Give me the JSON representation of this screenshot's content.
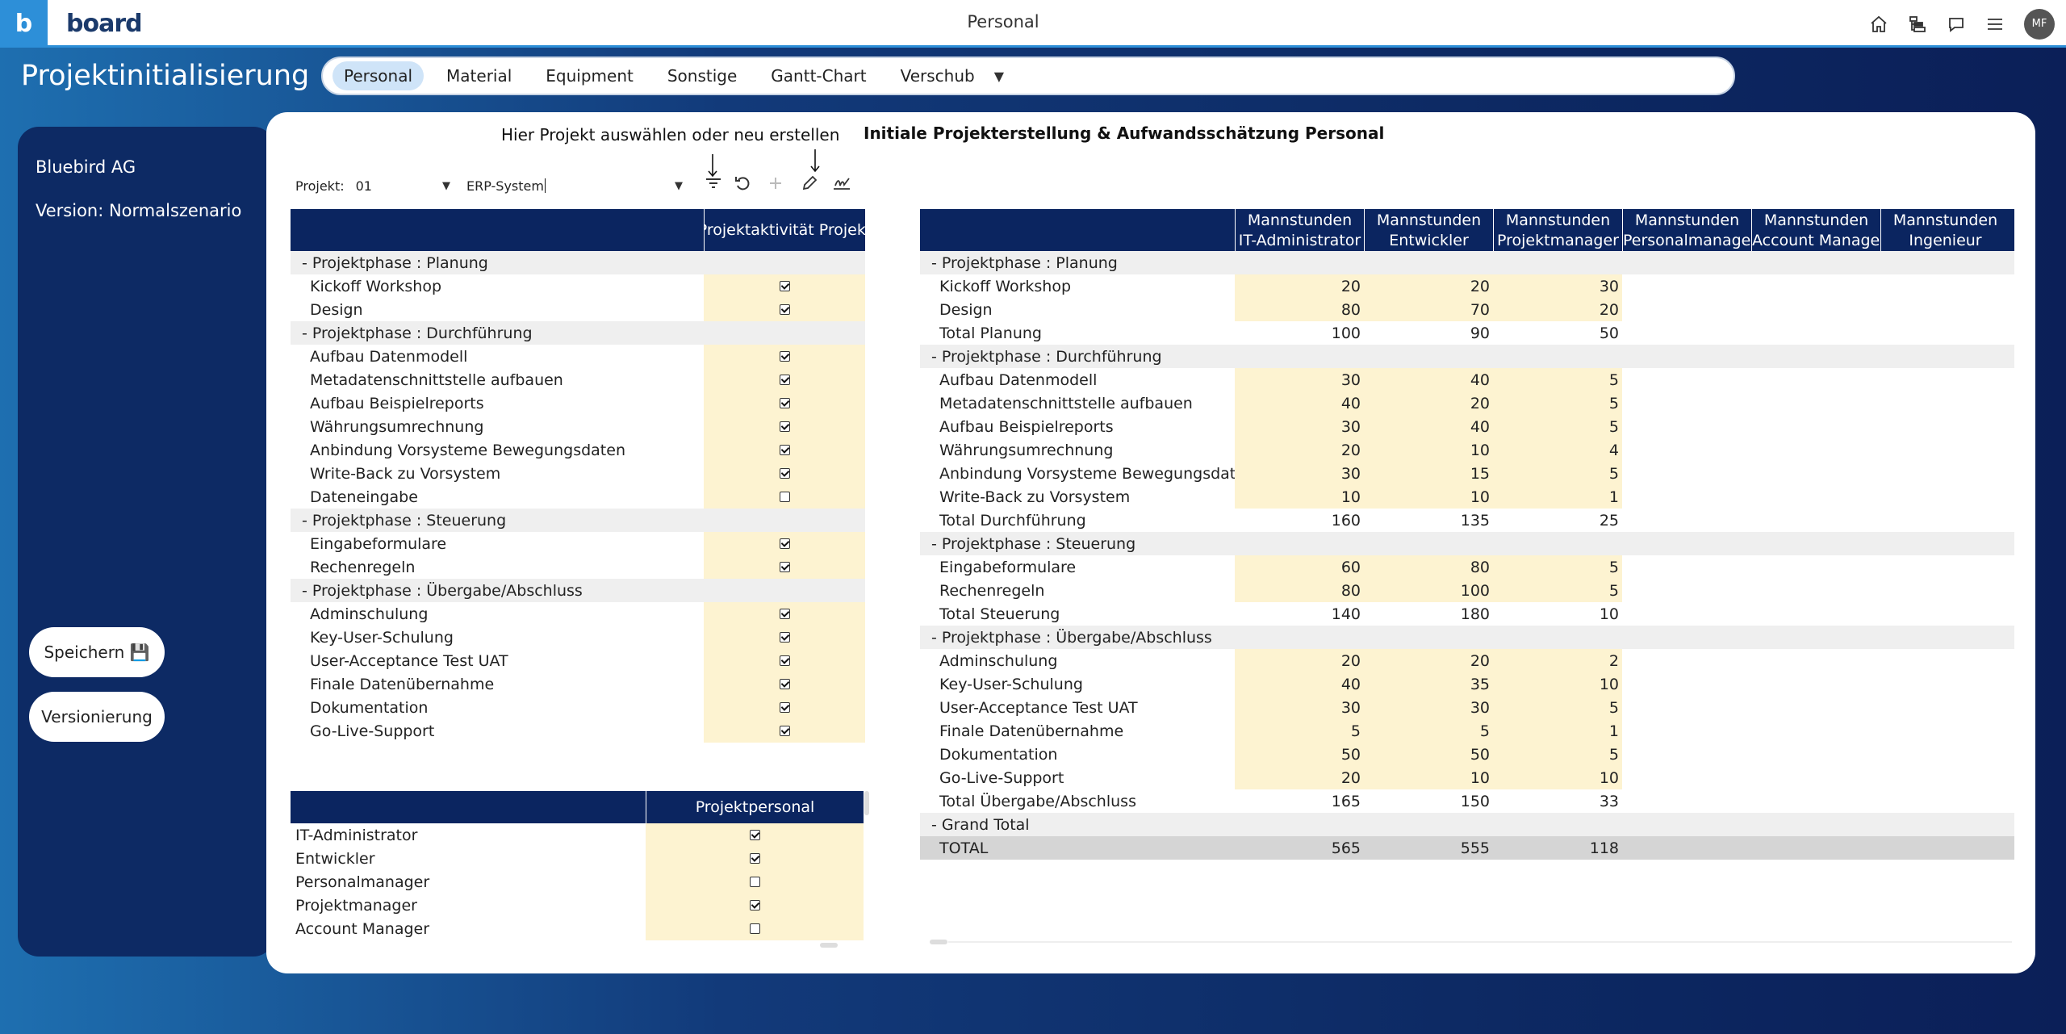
{
  "app": {
    "logo_letter": "b",
    "logo_name": "board",
    "window_title": "Personal",
    "avatar_initials": "MF"
  },
  "page": {
    "title": "Projektinitialisierung"
  },
  "tabs": [
    {
      "label": "Personal",
      "active": true
    },
    {
      "label": "Material",
      "active": false
    },
    {
      "label": "Equipment",
      "active": false
    },
    {
      "label": "Sonstige",
      "active": false
    },
    {
      "label": "Gantt-Chart",
      "active": false
    },
    {
      "label": "Verschub",
      "active": false
    }
  ],
  "tabs_more_symbol": "▼",
  "sidebar": {
    "company": "Bluebird AG",
    "version": "Version: Normalszenario",
    "save_label": "Speichern 💾",
    "versioning_label": "Versionierung"
  },
  "main": {
    "select_hint": "Hier Projekt auswählen oder neu erstellen",
    "right_title": "Initiale Projekterstellung & Aufwandsschätzung Personal",
    "project_label": "Projekt:",
    "project_value": "01",
    "system_value": "ERP-System",
    "caret": "▼"
  },
  "activity_grid": {
    "header": "Projektaktivität Projekt",
    "rows": [
      {
        "type": "phase",
        "label": "-  Projektphase : Planung"
      },
      {
        "type": "item",
        "label": "Kickoff Workshop",
        "checked": true
      },
      {
        "type": "item",
        "label": "Design",
        "checked": true
      },
      {
        "type": "phase",
        "label": "-  Projektphase : Durchführung"
      },
      {
        "type": "item",
        "label": "Aufbau Datenmodell",
        "checked": true
      },
      {
        "type": "item",
        "label": "Metadatenschnittstelle aufbauen",
        "checked": true
      },
      {
        "type": "item",
        "label": "Aufbau Beispielreports",
        "checked": true
      },
      {
        "type": "item",
        "label": "Währungsumrechnung",
        "checked": true
      },
      {
        "type": "item",
        "label": "Anbindung Vorsysteme Bewegungsdaten",
        "checked": true
      },
      {
        "type": "item",
        "label": "Write-Back zu Vorsystem",
        "checked": true
      },
      {
        "type": "item",
        "label": "Dateneingabe",
        "checked": false
      },
      {
        "type": "phase",
        "label": "-  Projektphase : Steuerung"
      },
      {
        "type": "item",
        "label": "Eingabeformulare",
        "checked": true
      },
      {
        "type": "item",
        "label": "Rechenregeln",
        "checked": true
      },
      {
        "type": "phase",
        "label": "-  Projektphase : Übergabe/Abschluss"
      },
      {
        "type": "item",
        "label": "Adminschulung",
        "checked": true
      },
      {
        "type": "item",
        "label": "Key-User-Schulung",
        "checked": true
      },
      {
        "type": "item",
        "label": "User-Acceptance Test UAT",
        "checked": true
      },
      {
        "type": "item",
        "label": "Finale Datenübernahme",
        "checked": true
      },
      {
        "type": "item",
        "label": "Dokumentation",
        "checked": true
      },
      {
        "type": "item",
        "label": "Go-Live-Support",
        "checked": true
      }
    ]
  },
  "personnel_grid": {
    "header": "Projektpersonal",
    "rows": [
      {
        "label": "IT-Administrator",
        "checked": true
      },
      {
        "label": "Entwickler",
        "checked": true
      },
      {
        "label": "Personalmanager",
        "checked": false
      },
      {
        "label": "Projektmanager",
        "checked": true
      },
      {
        "label": "Account Manager",
        "checked": false
      }
    ]
  },
  "hours_grid": {
    "columns": [
      {
        "line1": "Mannstunden",
        "line2": "IT-Administrator"
      },
      {
        "line1": "Mannstunden",
        "line2": "Entwickler"
      },
      {
        "line1": "Mannstunden",
        "line2": "Projektmanager"
      },
      {
        "line1": "Mannstunden",
        "line2": "Personalmanager"
      },
      {
        "line1": "Mannstunden",
        "line2": "Account Manager"
      },
      {
        "line1": "Mannstunden",
        "line2": "Ingenieur"
      }
    ],
    "rows": [
      {
        "type": "phase",
        "label": "-  Projektphase : Planung",
        "values": []
      },
      {
        "type": "item",
        "label": "Kickoff Workshop",
        "values": [
          "20",
          "20",
          "30"
        ]
      },
      {
        "type": "item",
        "label": "Design",
        "values": [
          "80",
          "70",
          "20"
        ]
      },
      {
        "type": "total",
        "label": "Total Planung",
        "values": [
          "100",
          "90",
          "50"
        ]
      },
      {
        "type": "phase",
        "label": "-  Projektphase : Durchführung",
        "values": []
      },
      {
        "type": "item",
        "label": "Aufbau Datenmodell",
        "values": [
          "30",
          "40",
          "5"
        ]
      },
      {
        "type": "item",
        "label": "Metadatenschnittstelle aufbauen",
        "values": [
          "40",
          "20",
          "5"
        ]
      },
      {
        "type": "item",
        "label": "Aufbau Beispielreports",
        "values": [
          "30",
          "40",
          "5"
        ]
      },
      {
        "type": "item",
        "label": "Währungsumrechnung",
        "values": [
          "20",
          "10",
          "4"
        ]
      },
      {
        "type": "item",
        "label": "Anbindung Vorsysteme Bewegungsdaten",
        "values": [
          "30",
          "15",
          "5"
        ]
      },
      {
        "type": "item",
        "label": "Write-Back zu Vorsystem",
        "values": [
          "10",
          "10",
          "1"
        ]
      },
      {
        "type": "total",
        "label": "Total Durchführung",
        "values": [
          "160",
          "135",
          "25"
        ]
      },
      {
        "type": "phase",
        "label": "-  Projektphase : Steuerung",
        "values": []
      },
      {
        "type": "item",
        "label": "Eingabeformulare",
        "values": [
          "60",
          "80",
          "5"
        ]
      },
      {
        "type": "item",
        "label": "Rechenregeln",
        "values": [
          "80",
          "100",
          "5"
        ]
      },
      {
        "type": "total",
        "label": "Total Steuerung",
        "values": [
          "140",
          "180",
          "10"
        ]
      },
      {
        "type": "phase",
        "label": "-  Projektphase : Übergabe/Abschluss",
        "values": []
      },
      {
        "type": "item",
        "label": "Adminschulung",
        "values": [
          "20",
          "20",
          "2"
        ]
      },
      {
        "type": "item",
        "label": "Key-User-Schulung",
        "values": [
          "40",
          "35",
          "10"
        ]
      },
      {
        "type": "item",
        "label": "User-Acceptance Test UAT",
        "values": [
          "30",
          "30",
          "5"
        ]
      },
      {
        "type": "item",
        "label": "Finale Datenübernahme",
        "values": [
          "5",
          "5",
          "1"
        ]
      },
      {
        "type": "item",
        "label": "Dokumentation",
        "values": [
          "50",
          "50",
          "5"
        ]
      },
      {
        "type": "item",
        "label": "Go-Live-Support",
        "values": [
          "20",
          "10",
          "10"
        ]
      },
      {
        "type": "total",
        "label": "Total Übergabe/Abschluss",
        "values": [
          "165",
          "150",
          "33"
        ]
      },
      {
        "type": "phase",
        "label": "-  Grand Total",
        "values": []
      },
      {
        "type": "grand",
        "label": "TOTAL",
        "values": [
          "565",
          "555",
          "118"
        ]
      }
    ]
  },
  "colors": {
    "accent": "#2d8fd8",
    "header_navy": "#0b2560",
    "input_yellow": "#fdf3d1",
    "phase_gray": "#efefef"
  }
}
